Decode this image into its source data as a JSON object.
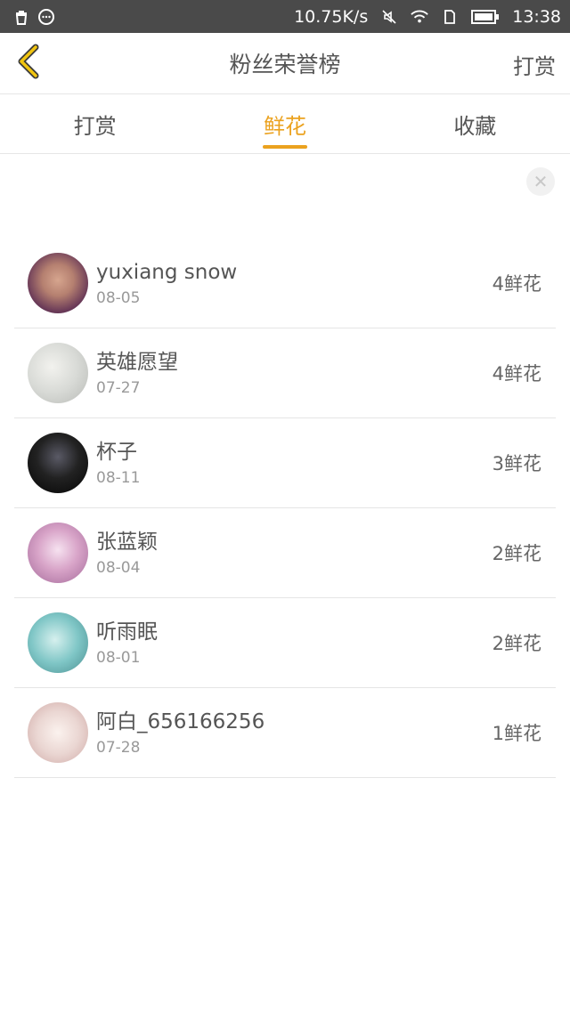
{
  "status_bar": {
    "speed": "10.75K/s",
    "time": "13:38",
    "icons": [
      "trash-icon",
      "chat-icon",
      "mute-icon",
      "wifi-icon",
      "sim-icon",
      "battery-icon"
    ]
  },
  "header": {
    "title": "粉丝荣誉榜",
    "right_action": "打赏",
    "back_icon": "chevron-left-icon",
    "accent_color": "#eba21f"
  },
  "tabs": [
    {
      "label": "打赏",
      "active": false
    },
    {
      "label": "鲜花",
      "active": true
    },
    {
      "label": "收藏",
      "active": false
    }
  ],
  "close_icon": "close-icon",
  "fans": [
    {
      "name": "yuxiang snow",
      "date": "08-05",
      "count": "4鲜花",
      "avatar_color": "#7a4a5a"
    },
    {
      "name": "英雄愿望",
      "date": "07-27",
      "count": "4鲜花",
      "avatar_color": "#cdd0cc"
    },
    {
      "name": "杯子",
      "date": "08-11",
      "count": "3鲜花",
      "avatar_color": "#111111"
    },
    {
      "name": "张蓝颖",
      "date": "08-04",
      "count": "2鲜花",
      "avatar_color": "#d8a4c8"
    },
    {
      "name": "听雨眠",
      "date": "08-01",
      "count": "2鲜花",
      "avatar_color": "#7fc6c6"
    },
    {
      "name": "阿白_656166256",
      "date": "07-28",
      "count": "1鲜花",
      "avatar_color": "#ead6d2"
    }
  ]
}
